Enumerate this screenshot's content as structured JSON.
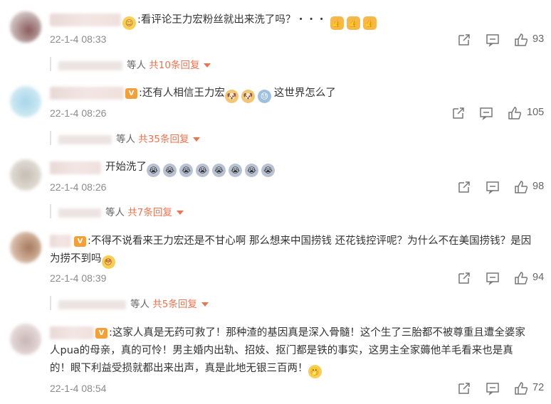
{
  "comments": [
    {
      "text": "看评论王力宏粉丝就出来洗了吗？・・・",
      "time": "22-1-4 08:33",
      "likes": "93",
      "reply_suffix": "等人",
      "reply_total": "共10条回复",
      "emojis": [
        "thumbs-up",
        "thumbs-up",
        "thumbs-up"
      ]
    },
    {
      "text": "还有人相信王力宏",
      "text_after": "这世界怎么了",
      "time": "22-1-4 08:26",
      "likes": "105",
      "reply_suffix": "等人",
      "reply_total": "共35条回复"
    },
    {
      "text": "开始洗了",
      "time": "22-1-4 08:26",
      "likes": "98",
      "reply_suffix": "等人",
      "reply_total": "共7条回复"
    },
    {
      "text_line1": "不得不说看来王力宏还是不甘心啊 那么想来中国捞钱 还花钱控评呢？为什么不在美国捞钱？是因",
      "text_line2": "为捞不到吗",
      "time": "22-1-4 08:39",
      "likes": "94",
      "reply_suffix": "等人",
      "reply_total": "共5条回复"
    },
    {
      "text_line1": "这家人真是无药可救了！那种渣的基因真是深入骨髓！这个生了三胎都不被尊重且遭全婆家",
      "text_line2": "人pua的母亲，真的可怜！男主婚内出轨、招妓、抠门都是铁的事实，这男主全家薅他羊毛看来也是真",
      "text_line3": "的！眼下利益受损就都出来出声，真是此地无银三百两！",
      "time": "22-1-4 08:54",
      "likes": "72"
    }
  ],
  "colors": {
    "accent": "#eb7350",
    "time": "#8b8b8b",
    "text": "#333333"
  },
  "icons": [
    "share-icon",
    "comment-icon",
    "like-icon"
  ]
}
